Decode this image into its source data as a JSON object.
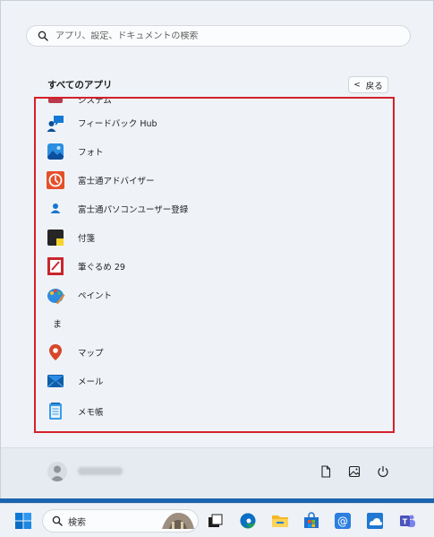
{
  "search": {
    "placeholder": "アプリ、設定、ドキュメントの検索"
  },
  "all_apps": {
    "title": "すべてのアプリ",
    "back_label": "戻る"
  },
  "apps": [
    {
      "label": "システム",
      "icon": "system-icon"
    },
    {
      "label": "フィードバック Hub",
      "icon": "feedback-hub-icon"
    },
    {
      "label": "フォト",
      "icon": "photos-icon"
    },
    {
      "label": "富士通アドバイザー",
      "icon": "fujitsu-advisor-icon"
    },
    {
      "label": "富士通パソコンユーザー登録",
      "icon": "user-registration-icon"
    },
    {
      "label": "付箋",
      "icon": "sticky-notes-icon"
    },
    {
      "label": "筆ぐるめ 29",
      "icon": "fudegurume-icon"
    },
    {
      "label": "ペイント",
      "icon": "paint-icon"
    },
    {
      "label": "ま",
      "icon": ""
    },
    {
      "label": "マップ",
      "icon": "maps-icon"
    },
    {
      "label": "メール",
      "icon": "mail-icon"
    },
    {
      "label": "メモ帳",
      "icon": "notepad-icon"
    }
  ],
  "footer": {
    "user_name": "",
    "buttons": [
      "documents-icon",
      "pictures-icon",
      "power-icon"
    ]
  },
  "taskbar": {
    "search_label": "検索",
    "items": [
      "windows-start-icon",
      "search-icon",
      "task-view-icon",
      "edge-icon",
      "file-explorer-icon",
      "store-icon",
      "mail-app-icon",
      "onedrive-icon",
      "teams-icon"
    ]
  },
  "colors": {
    "highlight": "#d5202a",
    "taskbar_blue": "#1b64ae",
    "accent": "#0067c0"
  }
}
